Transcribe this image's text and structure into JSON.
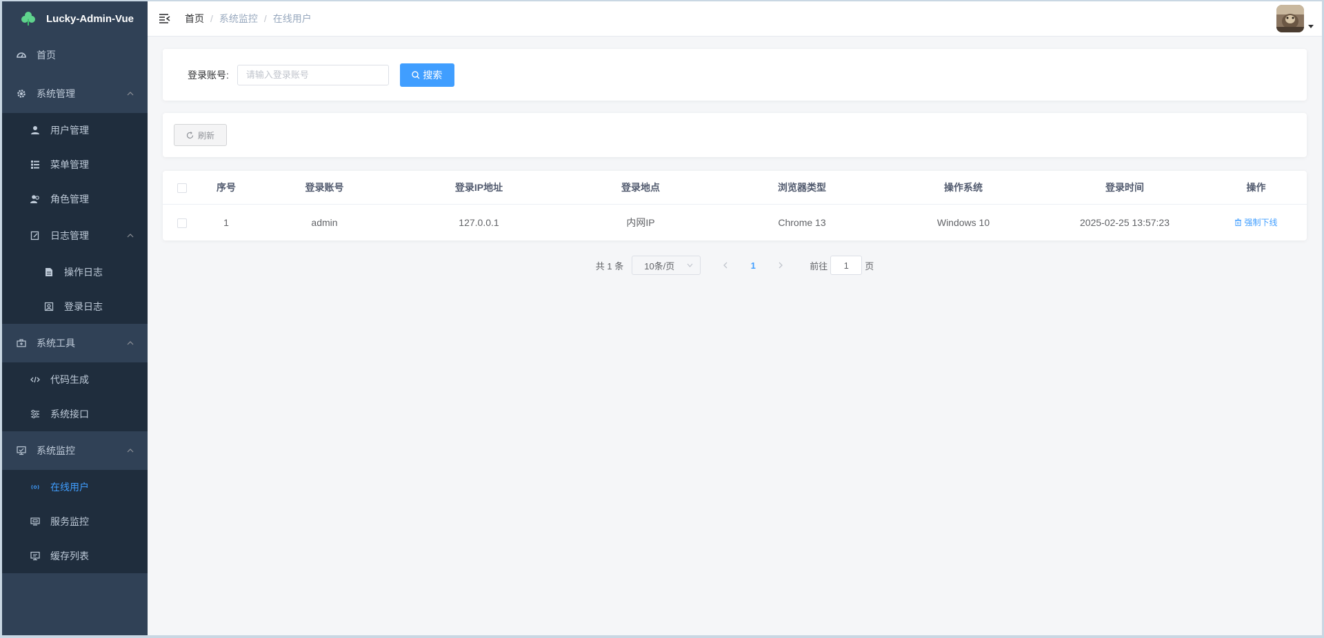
{
  "app": {
    "title": "Lucky-Admin-Vue"
  },
  "sidebar": {
    "items": [
      {
        "label": "首页"
      },
      {
        "label": "系统管理",
        "children": [
          {
            "label": "用户管理"
          },
          {
            "label": "菜单管理"
          },
          {
            "label": "角色管理"
          },
          {
            "label": "日志管理",
            "children": [
              {
                "label": "操作日志"
              },
              {
                "label": "登录日志"
              }
            ]
          }
        ]
      },
      {
        "label": "系统工具",
        "children": [
          {
            "label": "代码生成"
          },
          {
            "label": "系统接口"
          }
        ]
      },
      {
        "label": "系统监控",
        "children": [
          {
            "label": "在线用户"
          },
          {
            "label": "服务监控"
          },
          {
            "label": "缓存列表"
          }
        ]
      }
    ],
    "active_color": "#409eff"
  },
  "breadcrumb": {
    "home": "首页",
    "section": "系统监控",
    "current": "在线用户"
  },
  "search": {
    "label": "登录账号:",
    "placeholder": "请输入登录账号",
    "value": "",
    "button": "搜索"
  },
  "toolbar": {
    "refresh": "刷新"
  },
  "table": {
    "columns": [
      "序号",
      "登录账号",
      "登录IP地址",
      "登录地点",
      "浏览器类型",
      "操作系统",
      "登录时间",
      "操作"
    ],
    "rows": [
      {
        "index": "1",
        "account": "admin",
        "ip": "127.0.0.1",
        "location": "内网IP",
        "browser": "Chrome 13",
        "os": "Windows 10",
        "time": "2025-02-25 13:57:23",
        "action": "强制下线"
      }
    ]
  },
  "pagination": {
    "total": "共 1 条",
    "page_size": "10条/页",
    "current_page": "1",
    "goto_prefix": "前往",
    "goto_value": "1",
    "goto_suffix": "页"
  },
  "colors": {
    "sidebar_bg": "#304156",
    "submenu_bg": "#1f2d3d",
    "primary": "#409eff"
  }
}
